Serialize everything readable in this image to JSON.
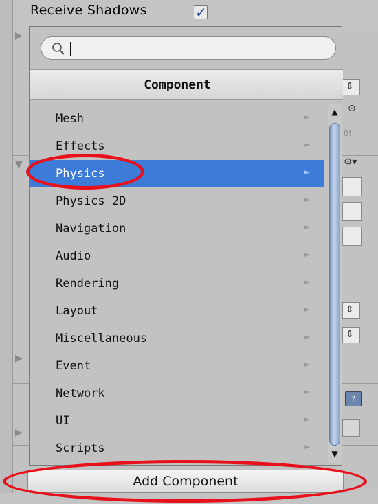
{
  "inspector": {
    "receive_shadows_label": "Receive Shadows",
    "receive_shadows_checked": true
  },
  "popup": {
    "search_placeholder": "",
    "header_title": "Component",
    "items": [
      {
        "label": "Mesh",
        "selected": false
      },
      {
        "label": "Effects",
        "selected": false
      },
      {
        "label": "Physics",
        "selected": true
      },
      {
        "label": "Physics 2D",
        "selected": false
      },
      {
        "label": "Navigation",
        "selected": false
      },
      {
        "label": "Audio",
        "selected": false
      },
      {
        "label": "Rendering",
        "selected": false
      },
      {
        "label": "Layout",
        "selected": false
      },
      {
        "label": "Miscellaneous",
        "selected": false
      },
      {
        "label": "Event",
        "selected": false
      },
      {
        "label": "Network",
        "selected": false
      },
      {
        "label": "UI",
        "selected": false
      },
      {
        "label": "Scripts",
        "selected": false
      }
    ],
    "submenu_arrow": "►"
  },
  "add_component_label": "Add Component",
  "colors": {
    "selection": "#3d7bd8",
    "annotation": "#e8101a",
    "scrollbar": "#8aa6cc"
  },
  "icons": {
    "search": "search-icon",
    "foldout": "foldout-arrow-icon",
    "checkmark": "checkmark-icon"
  }
}
